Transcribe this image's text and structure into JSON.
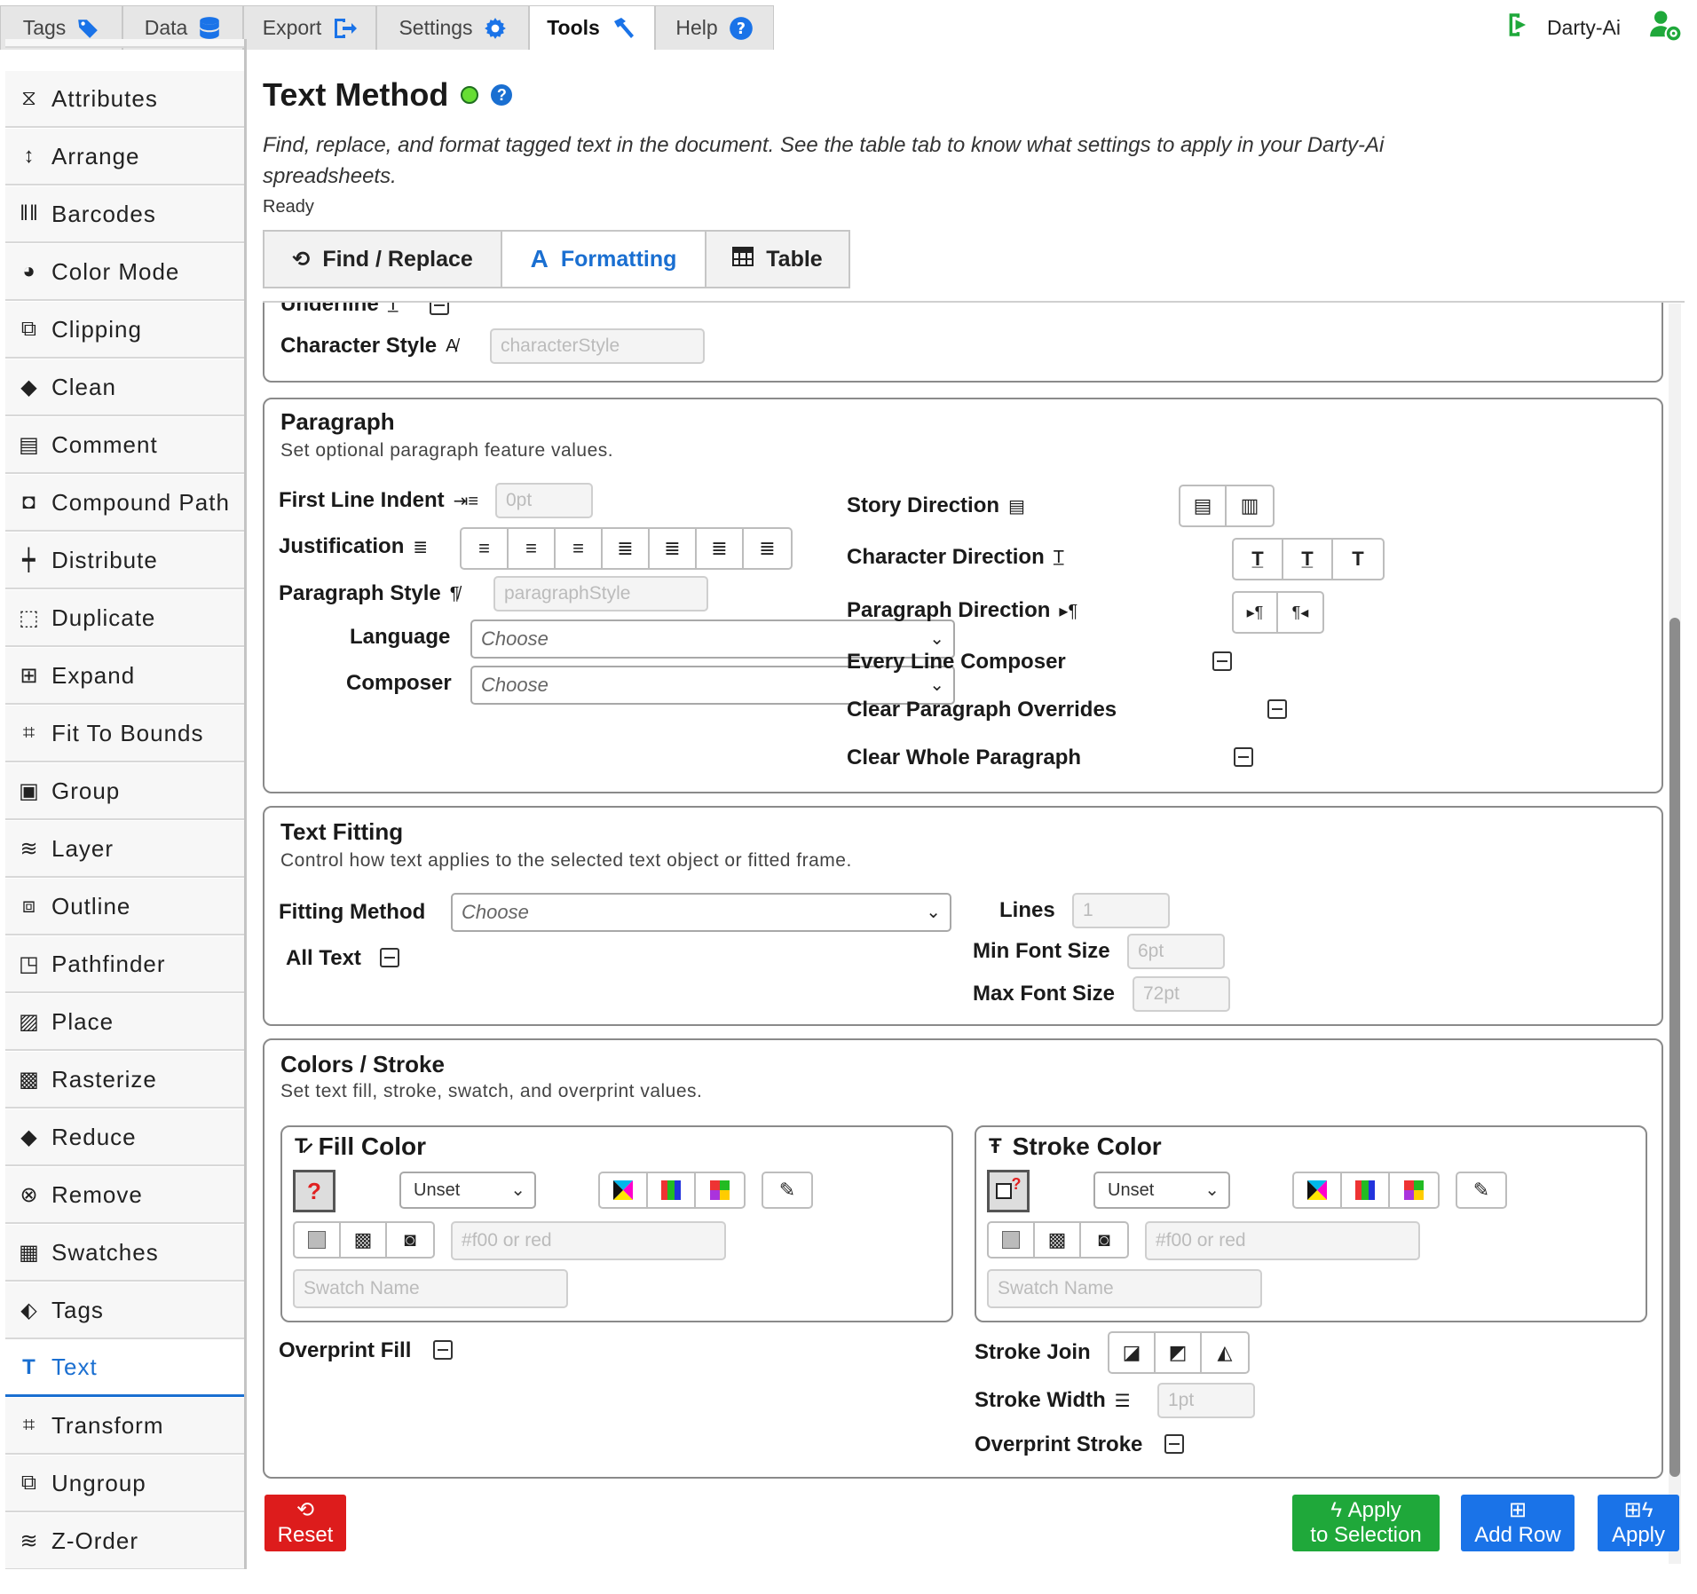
{
  "top_tabs": [
    {
      "label": "Tags",
      "icon": "tag-icon"
    },
    {
      "label": "Data",
      "icon": "database-icon"
    },
    {
      "label": "Export",
      "icon": "export-icon"
    },
    {
      "label": "Settings",
      "icon": "gear-icon"
    },
    {
      "label": "Tools",
      "icon": "hammer-icon"
    },
    {
      "label": "Help",
      "icon": "help-icon"
    }
  ],
  "user": {
    "name": "Darty-Ai"
  },
  "sidebar": {
    "items": [
      {
        "label": "Attributes"
      },
      {
        "label": "Arrange"
      },
      {
        "label": "Barcodes"
      },
      {
        "label": "Color Mode"
      },
      {
        "label": "Clipping"
      },
      {
        "label": "Clean"
      },
      {
        "label": "Comment"
      },
      {
        "label": "Compound Path"
      },
      {
        "label": "Distribute"
      },
      {
        "label": "Duplicate"
      },
      {
        "label": "Expand"
      },
      {
        "label": "Fit To Bounds"
      },
      {
        "label": "Group"
      },
      {
        "label": "Layer"
      },
      {
        "label": "Outline"
      },
      {
        "label": "Pathfinder"
      },
      {
        "label": "Place"
      },
      {
        "label": "Rasterize"
      },
      {
        "label": "Reduce"
      },
      {
        "label": "Remove"
      },
      {
        "label": "Swatches"
      },
      {
        "label": "Tags"
      },
      {
        "label": "Text"
      },
      {
        "label": "Transform"
      },
      {
        "label": "Ungroup"
      },
      {
        "label": "Z-Order"
      }
    ]
  },
  "page": {
    "title": "Text Method",
    "description": "Find, replace, and format tagged text in the document. See the table tab to know what settings to apply in your Darty-Ai spreadsheets.",
    "status": "Ready"
  },
  "subtabs": [
    {
      "label": "Find / Replace"
    },
    {
      "label": "Formatting"
    },
    {
      "label": "Table"
    }
  ],
  "character": {
    "underline_label": "Underline",
    "char_style_label": "Character Style",
    "char_style_placeholder": "characterStyle"
  },
  "paragraph": {
    "title": "Paragraph",
    "subtitle": "Set optional paragraph feature values.",
    "first_line_indent_label": "First Line Indent",
    "first_line_indent_placeholder": "0pt",
    "justification_label": "Justification",
    "paragraph_style_label": "Paragraph Style",
    "paragraph_style_placeholder": "paragraphStyle",
    "language_label": "Language",
    "language_value": "Choose",
    "composer_label": "Composer",
    "composer_value": "Choose",
    "story_direction_label": "Story Direction",
    "character_direction_label": "Character Direction",
    "paragraph_direction_label": "Paragraph Direction",
    "every_line_composer_label": "Every Line Composer",
    "clear_overrides_label": "Clear Paragraph Overrides",
    "clear_whole_label": "Clear Whole Paragraph"
  },
  "fitting": {
    "title": "Text Fitting",
    "subtitle": "Control how text applies to the selected text object or fitted frame.",
    "method_label": "Fitting Method",
    "method_value": "Choose",
    "all_text_label": "All Text",
    "lines_label": "Lines",
    "lines_placeholder": "1",
    "min_label": "Min Font Size",
    "min_placeholder": "6pt",
    "max_label": "Max Font Size",
    "max_placeholder": "72pt"
  },
  "colors": {
    "title": "Colors / Stroke",
    "subtitle": "Set text fill, stroke, swatch, and overprint values.",
    "fill_title": "Fill Color",
    "stroke_title": "Stroke Color",
    "fill_mode": "Unset",
    "stroke_mode": "Unset",
    "color_placeholder": "#f00 or red",
    "swatch_placeholder": "Swatch Name",
    "overprint_fill_label": "Overprint Fill",
    "stroke_join_label": "Stroke Join",
    "stroke_width_label": "Stroke Width",
    "stroke_width_placeholder": "1pt",
    "overprint_stroke_label": "Overprint Stroke",
    "question_mark": "?"
  },
  "buttons": {
    "reset": "Reset",
    "apply_selection_1": "Apply",
    "apply_selection_2": "to Selection",
    "add_row": "Add Row",
    "apply": "Apply"
  },
  "colors_theme": {
    "accent": "#1a6fd1",
    "green": "#1fa83a",
    "red": "#dd1c1c",
    "blue_btn": "#1a73e8"
  }
}
